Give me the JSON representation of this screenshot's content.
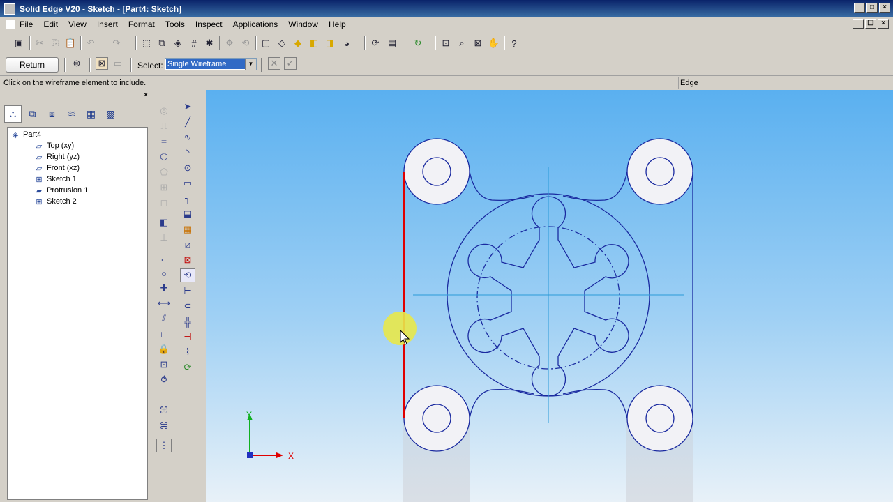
{
  "window": {
    "title": "Solid Edge V20 - Sketch - [Part4: Sketch]"
  },
  "menu": [
    "File",
    "Edit",
    "View",
    "Insert",
    "Format",
    "Tools",
    "Inspect",
    "Applications",
    "Window",
    "Help"
  ],
  "ribbon": {
    "return_label": "Return",
    "select_label": "Select:",
    "select_value": "Single Wireframe"
  },
  "status": {
    "prompt": "Click on the wireframe element to include.",
    "field": "Edge"
  },
  "tree": {
    "root": "Part4",
    "items": [
      {
        "label": "Top (xy)",
        "icon": "plane-icon"
      },
      {
        "label": "Right (yz)",
        "icon": "plane-icon"
      },
      {
        "label": "Front (xz)",
        "icon": "plane-icon"
      },
      {
        "label": "Sketch 1",
        "icon": "sketch-icon"
      },
      {
        "label": "Protrusion 1",
        "icon": "protrusion-icon"
      },
      {
        "label": "Sketch 2",
        "icon": "sketch-icon"
      }
    ]
  },
  "triad": {
    "x": "X",
    "y": "Y"
  },
  "colors": {
    "canvas_top": "#5ab0f0",
    "sketch": "#1a2aa0",
    "highlight": "#e00000",
    "cursor_halo": "#e8e84a"
  }
}
